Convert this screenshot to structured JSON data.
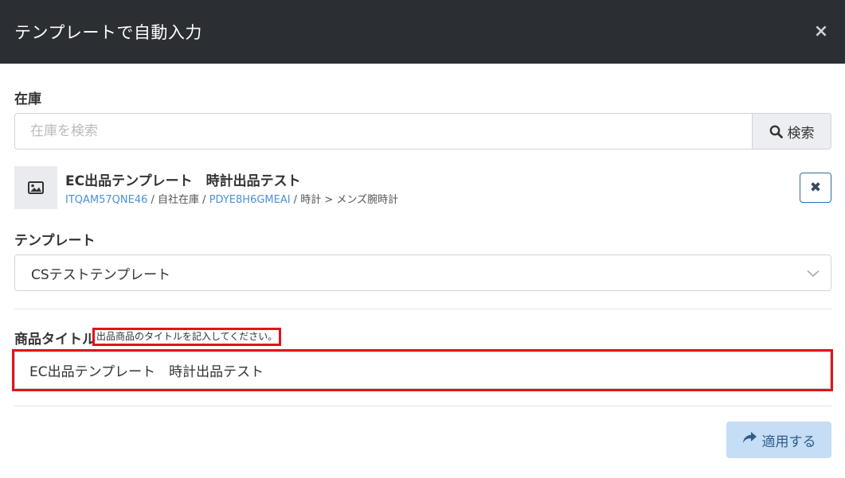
{
  "modal": {
    "title": "テンプレートで自動入力",
    "close_label": "×"
  },
  "stock": {
    "label": "在庫",
    "search_placeholder": "在庫を検索",
    "search_value": "",
    "search_button_label": "検索"
  },
  "selected_item": {
    "title": "EC出品テンプレート　時計出品テスト",
    "code": "ITQAM57QNE46",
    "sep1": " / ",
    "warehouse": "自社在庫",
    "sep2": " / ",
    "sku": "PDYE8H6GMEAI",
    "sep3": " / ",
    "category": "時計 > メンズ腕時計",
    "remove_label": "✖"
  },
  "template": {
    "label": "テンプレート",
    "selected_value": "CSテストテンプレート"
  },
  "product_title": {
    "label": "商品タイトル",
    "hint": "出品商品のタイトルを記入してください。",
    "value": "EC出品テンプレート　時計出品テスト"
  },
  "apply_button": {
    "label": "適用する"
  },
  "colors": {
    "header_bg": "#2b2e33",
    "highlight_red": "#e0141e",
    "link_blue": "#4a90d9",
    "apply_bg": "#c5ddf5"
  }
}
